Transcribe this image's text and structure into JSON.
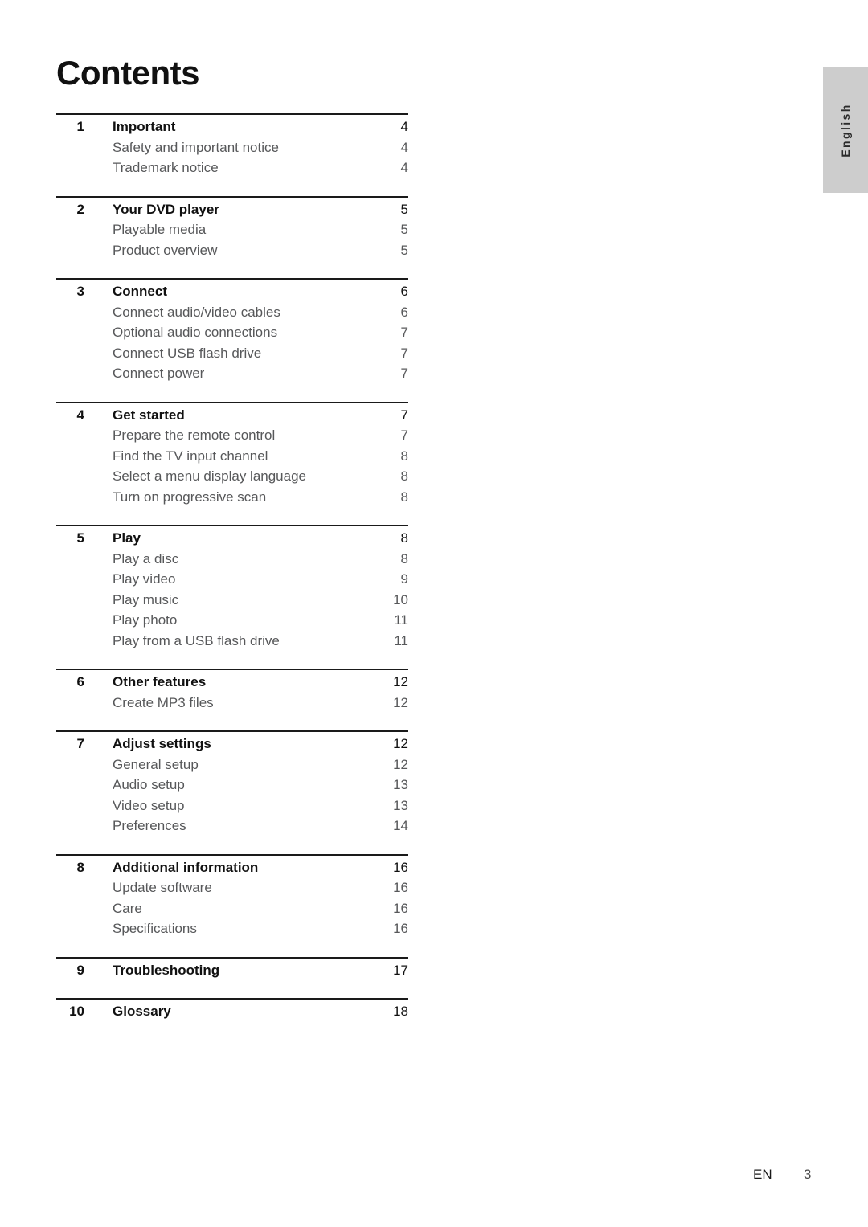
{
  "page_title": "Contents",
  "language_tab": {
    "label": "English",
    "background_color": "#cdcdcd"
  },
  "footer": {
    "language_code": "EN",
    "page_number": "3"
  },
  "colors": {
    "heading_text": "#111111",
    "sub_text": "#57585a",
    "rule": "#1a1a1a"
  },
  "toc": {
    "groups": [
      {
        "heading": {
          "num": "1",
          "label": "Important",
          "page": "4"
        },
        "items": [
          {
            "label": "Safety and important notice",
            "page": "4"
          },
          {
            "label": "Trademark notice",
            "page": "4"
          }
        ]
      },
      {
        "heading": {
          "num": "2",
          "label": "Your DVD player",
          "page": "5"
        },
        "items": [
          {
            "label": "Playable media",
            "page": "5"
          },
          {
            "label": "Product overview",
            "page": "5"
          }
        ]
      },
      {
        "heading": {
          "num": "3",
          "label": "Connect",
          "page": "6"
        },
        "items": [
          {
            "label": "Connect audio/video cables",
            "page": "6"
          },
          {
            "label": "Optional audio connections",
            "page": "7"
          },
          {
            "label": "Connect USB flash drive",
            "page": "7"
          },
          {
            "label": "Connect power",
            "page": "7"
          }
        ]
      },
      {
        "heading": {
          "num": "4",
          "label": "Get started",
          "page": "7"
        },
        "items": [
          {
            "label": "Prepare the remote control",
            "page": "7"
          },
          {
            "label": "Find the TV input channel",
            "page": "8"
          },
          {
            "label": "Select a menu display language",
            "page": "8"
          },
          {
            "label": "Turn on progressive scan",
            "page": "8"
          }
        ]
      },
      {
        "heading": {
          "num": "5",
          "label": "Play",
          "page": "8"
        },
        "items": [
          {
            "label": "Play a disc",
            "page": "8"
          },
          {
            "label": "Play video",
            "page": "9"
          },
          {
            "label": "Play music",
            "page": "10"
          },
          {
            "label": "Play photo",
            "page": "11"
          },
          {
            "label": "Play from a USB flash drive",
            "page": "11"
          }
        ]
      },
      {
        "heading": {
          "num": "6",
          "label": "Other features",
          "page": "12"
        },
        "items": [
          {
            "label": "Create MP3 files",
            "page": "12"
          }
        ]
      },
      {
        "heading": {
          "num": "7",
          "label": "Adjust settings",
          "page": "12"
        },
        "items": [
          {
            "label": "General setup",
            "page": "12"
          },
          {
            "label": "Audio setup",
            "page": "13"
          },
          {
            "label": "Video setup",
            "page": "13"
          },
          {
            "label": "Preferences",
            "page": "14"
          }
        ]
      },
      {
        "heading": {
          "num": "8",
          "label": "Additional information",
          "page": "16"
        },
        "items": [
          {
            "label": "Update software",
            "page": "16"
          },
          {
            "label": "Care",
            "page": "16"
          },
          {
            "label": "Specifications",
            "page": "16"
          }
        ]
      },
      {
        "heading": {
          "num": "9",
          "label": "Troubleshooting",
          "page": "17"
        },
        "items": []
      },
      {
        "heading": {
          "num": "10",
          "label": "Glossary",
          "page": "18"
        },
        "items": []
      }
    ]
  }
}
